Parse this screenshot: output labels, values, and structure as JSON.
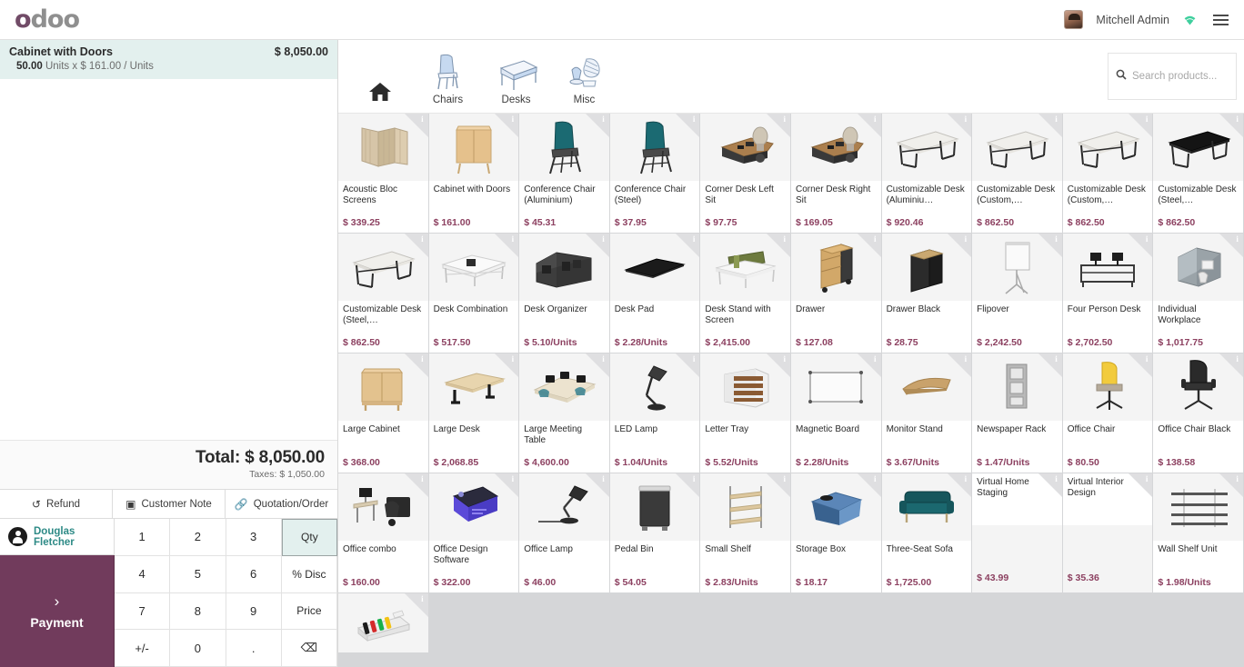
{
  "app": {
    "logo_text": "odoo",
    "user_name": "Mitchell Admin",
    "wifi_icon": "wifi-icon",
    "menu_icon": "hamburger-menu-icon"
  },
  "order": {
    "lines": [
      {
        "product": "Cabinet with Doors",
        "amount": "$ 8,050.00",
        "qty": "50.00",
        "detail": "Units x $ 161.00 / Units"
      }
    ],
    "total_label": "Total: $ 8,050.00",
    "taxes_label": "Taxes: $ 1,050.00"
  },
  "actions": [
    {
      "label": "Refund",
      "icon": "refund-icon"
    },
    {
      "label": "Customer Note",
      "icon": "note-icon"
    },
    {
      "label": "Quotation/Order",
      "icon": "link-icon"
    }
  ],
  "customer": {
    "name": "Douglas Fletcher",
    "icon": "person-icon"
  },
  "payment": {
    "label": "Payment",
    "chevron": "›",
    "color": "#713b5c"
  },
  "numpad": {
    "keys": [
      {
        "label": "1",
        "type": "digit"
      },
      {
        "label": "2",
        "type": "digit"
      },
      {
        "label": "3",
        "type": "digit"
      },
      {
        "label": "Qty",
        "type": "mode",
        "active": true
      },
      {
        "label": "4",
        "type": "digit"
      },
      {
        "label": "5",
        "type": "digit"
      },
      {
        "label": "6",
        "type": "digit"
      },
      {
        "label": "% Disc",
        "type": "mode",
        "active": false
      },
      {
        "label": "7",
        "type": "digit"
      },
      {
        "label": "8",
        "type": "digit"
      },
      {
        "label": "9",
        "type": "digit"
      },
      {
        "label": "Price",
        "type": "mode",
        "active": false
      },
      {
        "label": "+/-",
        "type": "digit"
      },
      {
        "label": "0",
        "type": "digit"
      },
      {
        "label": ".",
        "type": "digit"
      },
      {
        "label": "⌫",
        "type": "backspace"
      }
    ]
  },
  "categories": [
    {
      "label": "",
      "icon": "home-icon"
    },
    {
      "label": "Chairs",
      "icon": "chair-icon"
    },
    {
      "label": "Desks",
      "icon": "desk-icon"
    },
    {
      "label": "Misc",
      "icon": "misc-icon"
    }
  ],
  "search": {
    "placeholder": "Search products...",
    "value": "",
    "icon": "search-icon"
  },
  "products": [
    {
      "name": "Acoustic Bloc Screens",
      "price": "$ 339.25",
      "img": "screen"
    },
    {
      "name": "Cabinet with Doors",
      "price": "$ 161.00",
      "img": "cabinet"
    },
    {
      "name": "Conference Chair (Aluminium)",
      "price": "$ 45.31",
      "img": "chair-teal"
    },
    {
      "name": "Conference Chair (Steel)",
      "price": "$ 37.95",
      "img": "chair-teal"
    },
    {
      "name": "Corner Desk Left Sit",
      "price": "$ 97.75",
      "img": "corner-desk"
    },
    {
      "name": "Corner Desk Right Sit",
      "price": "$ 169.05",
      "img": "corner-desk"
    },
    {
      "name": "Customizable Desk (Aluminiu…",
      "price": "$ 920.46",
      "img": "desk-white"
    },
    {
      "name": "Customizable Desk (Custom,…",
      "price": "$ 862.50",
      "img": "desk-white"
    },
    {
      "name": "Customizable Desk (Custom,…",
      "price": "$ 862.50",
      "img": "desk-white"
    },
    {
      "name": "Customizable Desk (Steel,…",
      "price": "$ 862.50",
      "img": "desk-black"
    },
    {
      "name": "Customizable Desk (Steel,…",
      "price": "$ 862.50",
      "img": "desk-white"
    },
    {
      "name": "Desk Combination",
      "price": "$ 517.50",
      "img": "desk-combo"
    },
    {
      "name": "Desk Organizer",
      "price": "$ 5.10/Units",
      "img": "organizer"
    },
    {
      "name": "Desk Pad",
      "price": "$ 2.28/Units",
      "img": "pad"
    },
    {
      "name": "Desk Stand with Screen",
      "price": "$ 2,415.00",
      "img": "stand-screen"
    },
    {
      "name": "Drawer",
      "price": "$ 127.08",
      "img": "drawer-wood"
    },
    {
      "name": "Drawer Black",
      "price": "$ 28.75",
      "img": "drawer-black"
    },
    {
      "name": "Flipover",
      "price": "$ 2,242.50",
      "img": "flipover"
    },
    {
      "name": "Four Person Desk",
      "price": "$ 2,702.50",
      "img": "four-desk"
    },
    {
      "name": "Individual Workplace",
      "price": "$ 1,017.75",
      "img": "workplace"
    },
    {
      "name": "Large Cabinet",
      "price": "$ 368.00",
      "img": "cabinet-large"
    },
    {
      "name": "Large Desk",
      "price": "$ 2,068.85",
      "img": "large-desk"
    },
    {
      "name": "Large Meeting Table",
      "price": "$ 4,600.00",
      "img": "meeting-table"
    },
    {
      "name": "LED Lamp",
      "price": "$ 1.04/Units",
      "img": "lamp"
    },
    {
      "name": "Letter Tray",
      "price": "$ 5.52/Units",
      "img": "letter-tray"
    },
    {
      "name": "Magnetic Board",
      "price": "$ 2.28/Units",
      "img": "board"
    },
    {
      "name": "Monitor Stand",
      "price": "$ 3.67/Units",
      "img": "monitor-stand"
    },
    {
      "name": "Newspaper Rack",
      "price": "$ 1.47/Units",
      "img": "news-rack"
    },
    {
      "name": "Office Chair",
      "price": "$ 80.50",
      "img": "chair-yellow"
    },
    {
      "name": "Office Chair Black",
      "price": "$ 138.58",
      "img": "chair-black"
    },
    {
      "name": "Office combo",
      "price": "$ 160.00",
      "img": "combo"
    },
    {
      "name": "Office Design Software",
      "price": "$ 322.00",
      "img": "software-box"
    },
    {
      "name": "Office Lamp",
      "price": "$ 46.00",
      "img": "office-lamp"
    },
    {
      "name": "Pedal Bin",
      "price": "$ 54.05",
      "img": "bin"
    },
    {
      "name": "Small Shelf",
      "price": "$ 2.83/Units",
      "img": "small-shelf"
    },
    {
      "name": "Storage Box",
      "price": "$ 18.17",
      "img": "storage-box"
    },
    {
      "name": "Three-Seat Sofa",
      "price": "$ 1,725.00",
      "img": "sofa"
    },
    {
      "name": "Virtual Home Staging",
      "price": "$ 43.99",
      "img": "none",
      "name_top": true
    },
    {
      "name": "Virtual Interior Design",
      "price": "$ 35.36",
      "img": "none",
      "name_top": true
    },
    {
      "name": "Wall Shelf Unit",
      "price": "$ 1.98/Units",
      "img": "wall-shelf"
    }
  ],
  "partial_product": {
    "img": "pen-set"
  }
}
